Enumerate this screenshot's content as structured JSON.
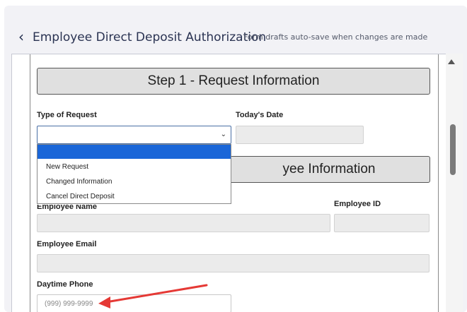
{
  "header": {
    "back_icon": "‹",
    "title": "Employee Direct Deposit Authorization",
    "subtitle": "Form drafts auto-save when changes are made"
  },
  "step1": {
    "title": "Step 1 - Request Information",
    "type_label": "Type of Request",
    "date_label": "Today's Date",
    "type_value": "",
    "date_value": ""
  },
  "type_dropdown": {
    "options": [
      "",
      "New Request",
      "Changed Information",
      "Cancel Direct Deposit"
    ],
    "highlighted_index": 0
  },
  "step2": {
    "title_visible": "yee Information",
    "name_label_visible": "Employee Name",
    "id_label": "Employee ID",
    "email_label": "Employee Email",
    "phone_label": "Daytime Phone",
    "phone_placeholder": "(999) 999-9999"
  },
  "annotation": {
    "arrow_color": "#e53935"
  }
}
